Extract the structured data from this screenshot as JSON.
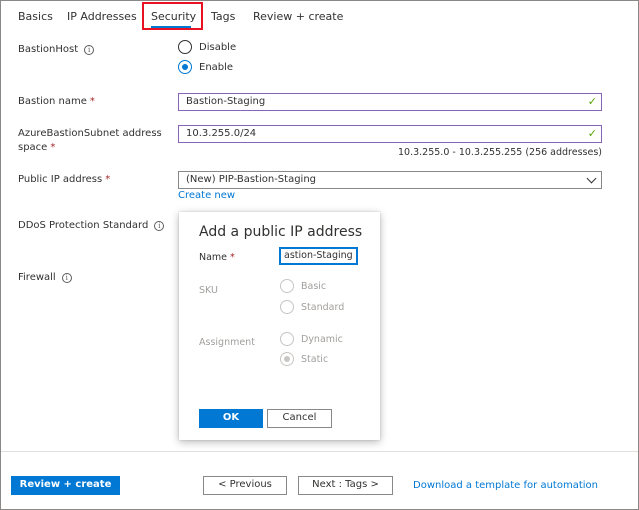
{
  "tabs": [
    {
      "label": "Basics"
    },
    {
      "label": "IP Addresses"
    },
    {
      "label": "Security"
    },
    {
      "label": "Tags"
    },
    {
      "label": "Review + create"
    }
  ],
  "form": {
    "bastion_host": {
      "label": "BastionHost",
      "options": [
        "Disable",
        "Enable"
      ],
      "selected": "Enable"
    },
    "bastion_name": {
      "label": "Bastion name",
      "required": "*",
      "value": "Bastion-Staging"
    },
    "subnet": {
      "label_line1": "AzureBastionSubnet address",
      "label_line2": "space",
      "required": "*",
      "value": "10.3.255.0/24",
      "hint": "10.3.255.0 - 10.3.255.255 (256 addresses)"
    },
    "public_ip": {
      "label": "Public IP address",
      "required": "*",
      "value": "(New) PIP-Bastion-Staging",
      "create_new": "Create new"
    },
    "ddos": {
      "label": "DDoS Protection Standard"
    },
    "firewall": {
      "label": "Firewall"
    }
  },
  "dialog": {
    "title": "Add a public IP address",
    "name_label": "Name",
    "name_required": "*",
    "name_value": "astion-Staging",
    "sku_label": "SKU",
    "sku_options": [
      "Basic",
      "Standard"
    ],
    "assignment_label": "Assignment",
    "assignment_options": [
      "Dynamic",
      "Static"
    ],
    "assignment_selected": "Static",
    "ok_label": "OK",
    "cancel_label": "Cancel"
  },
  "footer": {
    "review_create": "Review + create",
    "previous": "< Previous",
    "next": "Next : Tags >",
    "download_link": "Download a template for automation"
  },
  "colors": {
    "accent": "#0078d4",
    "highlight_box": "#e81123",
    "valid_border": "#8764b8",
    "valid_check": "#57a300",
    "required": "#a4262c"
  },
  "icons": {
    "info": "info-icon",
    "check": "checkmark-icon",
    "dropdown": "chevron-down-icon"
  }
}
